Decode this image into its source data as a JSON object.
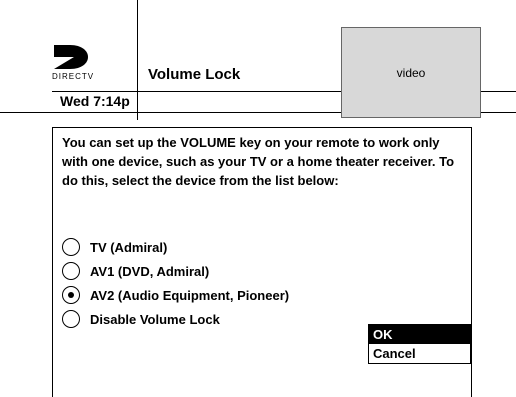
{
  "header": {
    "logo_text": "DIRECTV",
    "title": "Volume Lock",
    "clock": "Wed 7:14p",
    "video_label": "video"
  },
  "main": {
    "message": "You can set up the VOLUME key on your remote to work only with one device, such as your TV or a home theater receiver. To do this, select the device from the list below:",
    "options": [
      {
        "label": "TV (Admiral)",
        "selected": false
      },
      {
        "label": "AV1 (DVD, Admiral)",
        "selected": false
      },
      {
        "label": "AV2 (Audio Equipment, Pioneer)",
        "selected": true
      },
      {
        "label": "Disable Volume Lock",
        "selected": false
      }
    ],
    "buttons": {
      "ok_label": "OK",
      "cancel_label": "Cancel",
      "focused": "OK"
    }
  },
  "icons": {
    "logo": "directv-logo-icon",
    "radio_unchecked": "radio-unchecked-icon",
    "radio_checked": "radio-checked-icon"
  }
}
